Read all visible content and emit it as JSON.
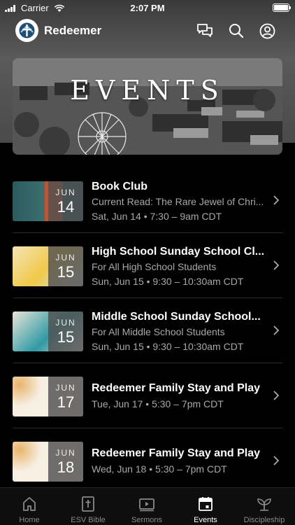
{
  "status_bar": {
    "carrier": "Carrier",
    "time": "2:07 PM"
  },
  "header": {
    "title": "Redeemer",
    "icons": [
      "chat-icon",
      "search-icon",
      "profile-icon"
    ]
  },
  "banner": {
    "title": "EVENTS"
  },
  "events": [
    {
      "title": "Book Club",
      "subtitle": "Current Read: The Rare Jewel of Chri...",
      "time": "Sat, Jun 14 • 7:30 – 9am CDT",
      "month": "JUN",
      "day": "14",
      "thumb_color": "#2e5a5e"
    },
    {
      "title": "High School Sunday School Cl...",
      "subtitle": "For All High School Students",
      "time": "Sun, Jun 15 • 9:30 – 10:30am CDT",
      "month": "JUN",
      "day": "15",
      "thumb_color": "#f3e3b8"
    },
    {
      "title": "Middle School Sunday School...",
      "subtitle": "For All Middle School Students",
      "time": "Sun, Jun 15 • 9:30 – 10:30am CDT",
      "month": "JUN",
      "day": "15",
      "thumb_color": "#e8e2d6"
    },
    {
      "title": "Redeemer Family Stay and Play",
      "subtitle": "",
      "time": "Tue, Jun 17 • 5:30 – 7pm CDT",
      "month": "JUN",
      "day": "17",
      "thumb_color": "#f6efe2"
    },
    {
      "title": "Redeemer Family Stay and Play",
      "subtitle": "",
      "time": "Wed, Jun 18 • 5:30 – 7pm CDT",
      "month": "JUN",
      "day": "18",
      "thumb_color": "#f6efe2"
    }
  ],
  "tabs": [
    {
      "label": "Home",
      "icon": "home-icon",
      "active": false
    },
    {
      "label": "ESV Bible",
      "icon": "bible-icon",
      "active": false
    },
    {
      "label": "Sermons",
      "icon": "video-icon",
      "active": false
    },
    {
      "label": "Events",
      "icon": "calendar-icon",
      "active": true
    },
    {
      "label": "Discipleship",
      "icon": "sprout-icon",
      "active": false
    }
  ],
  "colors": {
    "background": "#000000",
    "text_secondary": "#a8a8a8",
    "tab_inactive": "#8a8a8a"
  }
}
